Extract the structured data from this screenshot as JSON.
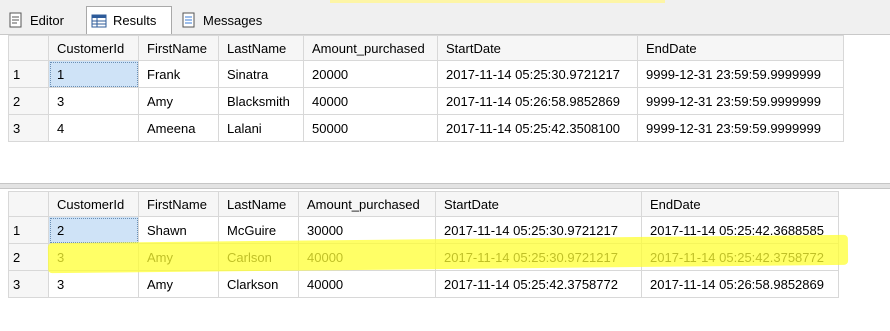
{
  "tabs": {
    "editor": "Editor",
    "results": "Results",
    "messages": "Messages"
  },
  "columns": [
    "CustomerId",
    "FirstName",
    "LastName",
    "Amount_purchased",
    "StartDate",
    "EndDate"
  ],
  "grid1": {
    "rows": [
      {
        "n": "1",
        "id": "1",
        "first": "Frank",
        "last": "Sinatra",
        "amount": "20000",
        "start": "2017-11-14 05:25:30.9721217",
        "end": "9999-12-31 23:59:59.9999999"
      },
      {
        "n": "2",
        "id": "3",
        "first": "Amy",
        "last": "Blacksmith",
        "amount": "40000",
        "start": "2017-11-14 05:26:58.9852869",
        "end": "9999-12-31 23:59:59.9999999"
      },
      {
        "n": "3",
        "id": "4",
        "first": "Ameena",
        "last": "Lalani",
        "amount": "50000",
        "start": "2017-11-14 05:25:42.3508100",
        "end": "9999-12-31 23:59:59.9999999"
      }
    ]
  },
  "grid2": {
    "rows": [
      {
        "n": "1",
        "id": "2",
        "first": "Shawn",
        "last": "McGuire",
        "amount": "30000",
        "start": "2017-11-14 05:25:30.9721217",
        "end": "2017-11-14 05:25:42.3688585"
      },
      {
        "n": "2",
        "id": "3",
        "first": "Amy",
        "last": "Carlson",
        "amount": "40000",
        "start": "2017-11-14 05:25:30.9721217",
        "end": "2017-11-14 05:25:42.3758772"
      },
      {
        "n": "3",
        "id": "3",
        "first": "Amy",
        "last": "Clarkson",
        "amount": "40000",
        "start": "2017-11-14 05:25:42.3758772",
        "end": "2017-11-14 05:26:58.9852869"
      }
    ]
  },
  "colors": {
    "highlight": "#ffff33",
    "selected": "#cfe3f7"
  }
}
